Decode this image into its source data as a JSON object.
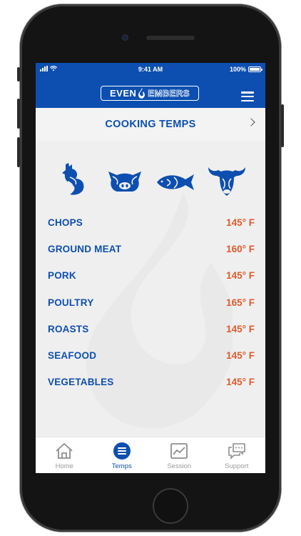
{
  "status_bar": {
    "time": "9:41 AM",
    "battery": "100%",
    "battery_level": 1.0
  },
  "header": {
    "logo_even": "EVEN",
    "logo_embers": "EMBERS"
  },
  "title_bar": {
    "title": "COOKING TEMPS"
  },
  "animal_icons": [
    "chicken-icon",
    "pig-icon",
    "fish-icon",
    "cow-icon"
  ],
  "temps": [
    {
      "name": "CHOPS",
      "value": "145° F"
    },
    {
      "name": "GROUND MEAT",
      "value": "160° F"
    },
    {
      "name": "PORK",
      "value": "145° F"
    },
    {
      "name": "POULTRY",
      "value": "165° F"
    },
    {
      "name": "ROASTS",
      "value": "145° F"
    },
    {
      "name": "SEAFOOD",
      "value": "145° F"
    },
    {
      "name": "VEGETABLES",
      "value": "145° F"
    }
  ],
  "tab_bar": {
    "active": "Temps",
    "tabs": [
      {
        "label": "Home",
        "icon": "home-icon"
      },
      {
        "label": "Temps",
        "icon": "list-icon"
      },
      {
        "label": "Session",
        "icon": "chart-icon"
      },
      {
        "label": "Support",
        "icon": "chat-icon"
      }
    ]
  },
  "colors": {
    "brand_blue": "#0d4fb0",
    "temp_orange": "#e05a2c",
    "background": "#efefef"
  }
}
